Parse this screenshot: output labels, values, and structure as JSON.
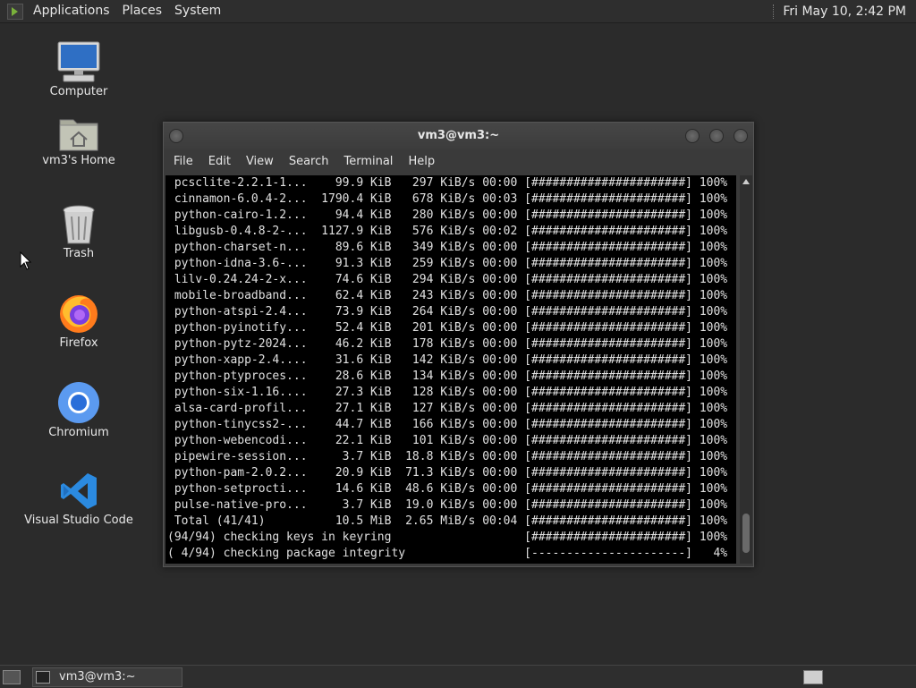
{
  "top_panel": {
    "menus": [
      "Applications",
      "Places",
      "System"
    ],
    "clock": "Fri May 10,  2:42 PM"
  },
  "desktop_icons": [
    {
      "label": "Computer",
      "icon": "computer-icon"
    },
    {
      "label": "vm3's Home",
      "icon": "home-folder-icon"
    },
    {
      "label": "Trash",
      "icon": "trash-icon"
    },
    {
      "label": "Firefox",
      "icon": "firefox-icon"
    },
    {
      "label": "Chromium",
      "icon": "chromium-icon"
    },
    {
      "label": "Visual Studio Code",
      "icon": "vscode-icon"
    }
  ],
  "terminal": {
    "title": "vm3@vm3:~",
    "menu": [
      "File",
      "Edit",
      "View",
      "Search",
      "Terminal",
      "Help"
    ],
    "lines": [
      " pcsclite-2.2.1-1...    99.9 KiB   297 KiB/s 00:00 [######################] 100%",
      " cinnamon-6.0.4-2...  1790.4 KiB   678 KiB/s 00:03 [######################] 100%",
      " python-cairo-1.2...    94.4 KiB   280 KiB/s 00:00 [######################] 100%",
      " libgusb-0.4.8-2-...  1127.9 KiB   576 KiB/s 00:02 [######################] 100%",
      " python-charset-n...    89.6 KiB   349 KiB/s 00:00 [######################] 100%",
      " python-idna-3.6-...    91.3 KiB   259 KiB/s 00:00 [######################] 100%",
      " lilv-0.24.24-2-x...    74.6 KiB   294 KiB/s 00:00 [######################] 100%",
      " mobile-broadband...    62.4 KiB   243 KiB/s 00:00 [######################] 100%",
      " python-atspi-2.4...    73.9 KiB   264 KiB/s 00:00 [######################] 100%",
      " python-pyinotify...    52.4 KiB   201 KiB/s 00:00 [######################] 100%",
      " python-pytz-2024...    46.2 KiB   178 KiB/s 00:00 [######################] 100%",
      " python-xapp-2.4....    31.6 KiB   142 KiB/s 00:00 [######################] 100%",
      " python-ptyproces...    28.6 KiB   134 KiB/s 00:00 [######################] 100%",
      " python-six-1.16....    27.3 KiB   128 KiB/s 00:00 [######################] 100%",
      " alsa-card-profil...    27.1 KiB   127 KiB/s 00:00 [######################] 100%",
      " python-tinycss2-...    44.7 KiB   166 KiB/s 00:00 [######################] 100%",
      " python-webencodi...    22.1 KiB   101 KiB/s 00:00 [######################] 100%",
      " pipewire-session...     3.7 KiB  18.8 KiB/s 00:00 [######################] 100%",
      " python-pam-2.0.2...    20.9 KiB  71.3 KiB/s 00:00 [######################] 100%",
      " python-setprocti...    14.6 KiB  48.6 KiB/s 00:00 [######################] 100%",
      " pulse-native-pro...     3.7 KiB  19.0 KiB/s 00:00 [######################] 100%",
      " Total (41/41)          10.5 MiB  2.65 MiB/s 00:04 [######################] 100%",
      "(94/94) checking keys in keyring                   [######################] 100%",
      "( 4/94) checking package integrity                 [----------------------]   4%"
    ]
  },
  "taskbar": {
    "window_button": "vm3@vm3:~"
  }
}
